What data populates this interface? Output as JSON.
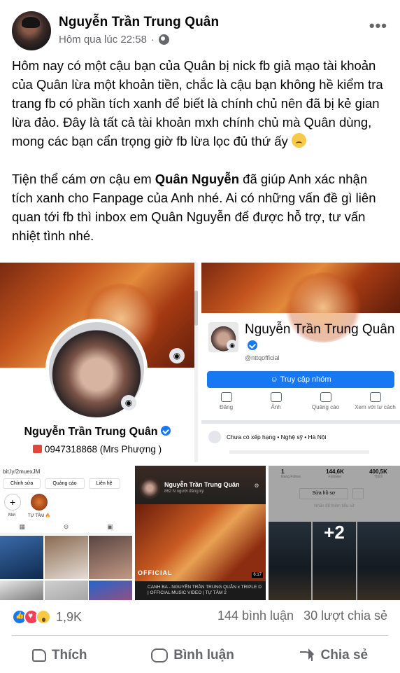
{
  "post": {
    "author": "Nguyễn Trần Trung Quân",
    "timestamp": "Hôm qua lúc 22:58",
    "separator": "·",
    "privacy_icon": "globe-icon",
    "more_icon": "more-options-icon",
    "more_label": "•••",
    "paragraph1": "Hôm nay có một cậu bạn của Quân bị nick fb giả mạo tài khoản của Quân lừa một khoản tiền, chắc là cậu bạn không hề kiểm tra trang fb có phần tích xanh để biết là chính chủ nên đã bị kẻ gian lừa đảo. Đây là tất cả tài khoản mxh chính chủ mà Quân dùng, mong các bạn cẩn trọng giờ fb lừa lọc đủ thứ ấy",
    "paragraph2_before": "Tiện thể cám ơn cậu em ",
    "paragraph2_bold": "Quân Nguyễn",
    "paragraph2_after": " đã giúp Anh xác nhận tích xanh cho Fanpage của Anh nhé. Ai có những vấn đề gì liên quan tới fb thì inbox em Quân Nguyễn để được hỗ trợ, tư vấn nhiệt tình nhé."
  },
  "images": {
    "fb_profile": {
      "name": "Nguyễn Trần Trung Quân",
      "phone": "0947318868 (Mrs Phượng )"
    },
    "fanpage": {
      "name": "Nguyễn Trần Trung Quân",
      "handle": "@nttqofficial",
      "join_button": "☺ Truy cập nhóm",
      "actions": [
        "Đăng",
        "Ảnh",
        "Quảng cáo",
        "Xem với tư cách"
      ],
      "rating": "Chưa có xếp hạng • Nghệ sỹ • Hà Nội"
    },
    "instagram": {
      "url": "bit.ly/2muexJM",
      "buttons": [
        "Chỉnh sửa",
        "Quảng cáo",
        "Liên hệ"
      ],
      "highlight_new": "Mới",
      "highlight_label": "TỰ TÂM 🔥",
      "highlight_plus": "+"
    },
    "youtube": {
      "channel": "Nguyễn Trần Trung Quân",
      "subscribers": "862 N người đăng ký",
      "banner": "OFFICIAL",
      "duration": "6:17",
      "video_title": "CANH BA - NGUYỄN TRẦN TRUNG QUÂN x TRIPLE D | OFFICIAL MUSIC VIDEO | TỰ TÂM 2"
    },
    "tiktok": {
      "stats": [
        {
          "value": "1",
          "label": "Đang Follow"
        },
        {
          "value": "144,6K",
          "label": "Follower"
        },
        {
          "value": "400,5K",
          "label": "Thích"
        }
      ],
      "edit_profile": "Sửa hồ sơ",
      "bio_hint": "Nhấn để thêm tiểu sử",
      "more_count": "+2"
    }
  },
  "reactions": {
    "icons": [
      "like-reaction-icon",
      "love-reaction-icon",
      "wow-reaction-icon"
    ],
    "count": "1,9K",
    "comments": "144 bình luận",
    "shares": "30 lượt chia sẻ"
  },
  "action_bar": {
    "like": "Thích",
    "comment": "Bình luận",
    "share": "Chia sẻ"
  },
  "colors": {
    "accent": "#1877f2",
    "secondary_text": "#65676b",
    "love": "#f33e58",
    "wow": "#f7c948"
  }
}
